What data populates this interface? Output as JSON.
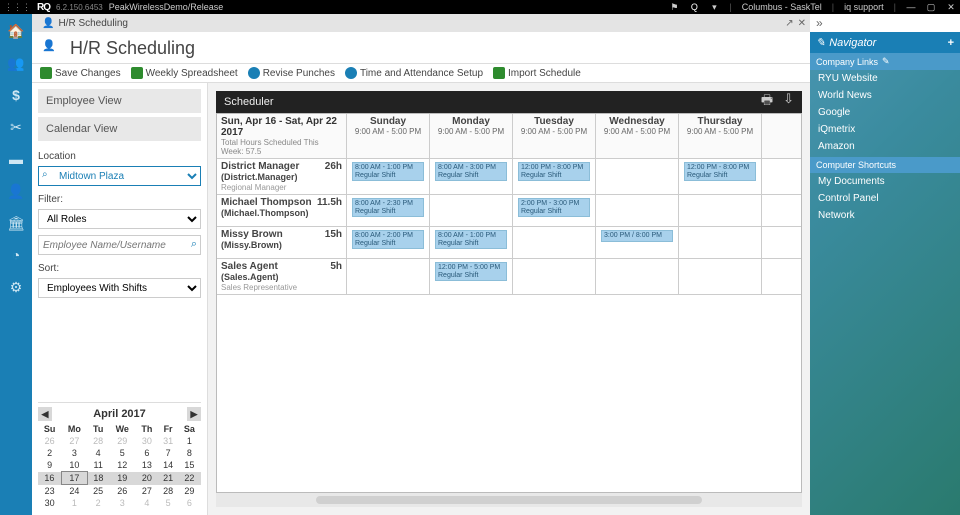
{
  "titlebar": {
    "version": "6.2.150.6453",
    "title": "PeakWirelessDemo/Release",
    "region": "Columbus - SaskTel",
    "support": "iq support"
  },
  "tab": {
    "title": "H/R Scheduling"
  },
  "page": {
    "title": "H/R Scheduling"
  },
  "toolbar": {
    "save": "Save Changes",
    "weekly": "Weekly Spreadsheet",
    "revise": "Revise Punches",
    "time": "Time and Attendance Setup",
    "import": "Import Schedule"
  },
  "sidepane": {
    "empview": "Employee View",
    "calview": "Calendar View",
    "locationLabel": "Location",
    "location": "Midtown Plaza",
    "filterLabel": "Filter:",
    "filter": "All Roles",
    "searchPh": "Employee Name/Username",
    "sortLabel": "Sort:",
    "sort": "Employees With Shifts"
  },
  "minical": {
    "month": "April  2017",
    "dow": [
      "Su",
      "Mo",
      "Tu",
      "We",
      "Th",
      "Fr",
      "Sa"
    ],
    "weeks": [
      [
        {
          "d": "26",
          "o": 1
        },
        {
          "d": "27",
          "o": 1
        },
        {
          "d": "28",
          "o": 1
        },
        {
          "d": "29",
          "o": 1
        },
        {
          "d": "30",
          "o": 1
        },
        {
          "d": "31",
          "o": 1
        },
        {
          "d": "1"
        }
      ],
      [
        {
          "d": "2"
        },
        {
          "d": "3"
        },
        {
          "d": "4"
        },
        {
          "d": "5"
        },
        {
          "d": "6"
        },
        {
          "d": "7"
        },
        {
          "d": "8"
        }
      ],
      [
        {
          "d": "9"
        },
        {
          "d": "10"
        },
        {
          "d": "11"
        },
        {
          "d": "12"
        },
        {
          "d": "13"
        },
        {
          "d": "14"
        },
        {
          "d": "15"
        }
      ],
      [
        {
          "d": "16"
        },
        {
          "d": "17",
          "today": 1
        },
        {
          "d": "18"
        },
        {
          "d": "19"
        },
        {
          "d": "20"
        },
        {
          "d": "21"
        },
        {
          "d": "22"
        }
      ],
      [
        {
          "d": "23"
        },
        {
          "d": "24"
        },
        {
          "d": "25"
        },
        {
          "d": "26"
        },
        {
          "d": "27"
        },
        {
          "d": "28"
        },
        {
          "d": "29"
        }
      ],
      [
        {
          "d": "30"
        },
        {
          "d": "1",
          "o": 1
        },
        {
          "d": "2",
          "o": 1
        },
        {
          "d": "3",
          "o": 1
        },
        {
          "d": "4",
          "o": 1
        },
        {
          "d": "5",
          "o": 1
        },
        {
          "d": "6",
          "o": 1
        }
      ]
    ],
    "selweek": 3
  },
  "sched": {
    "title": "Scheduler",
    "range": "Sun, Apr 16 - Sat, Apr 22 2017",
    "totalhrs": "Total Hours Scheduled This Week: 57.5",
    "days": [
      {
        "name": "Sunday",
        "hrs": "9:00 AM - 5:00 PM"
      },
      {
        "name": "Monday",
        "hrs": "9:00 AM - 5:00 PM"
      },
      {
        "name": "Tuesday",
        "hrs": "9:00 AM - 5:00 PM"
      },
      {
        "name": "Wednesday",
        "hrs": "9:00 AM - 5:00 PM"
      },
      {
        "name": "Thursday",
        "hrs": "9:00 AM - 5:00 PM"
      }
    ],
    "rows": [
      {
        "name": "District Manager",
        "user": "(District.Manager)",
        "role": "Regional Manager",
        "hrs": "26h",
        "cells": [
          "8:00 AM - 1:00 PM\nRegular Shift",
          "8:00 AM - 3:00 PM\nRegular Shift",
          "12:00 PM - 8:00 PM\nRegular Shift",
          "",
          "12:00 PM - 8:00 PM\nRegular Shift"
        ]
      },
      {
        "name": "Michael Thompson",
        "user": "(Michael.Thompson)",
        "role": "",
        "hrs": "11.5h",
        "cells": [
          "8:00 AM - 2:30\nPM\nRegular Shift",
          "",
          "2:00 PM - 3:00\nPM\nRegular Shift",
          "",
          ""
        ]
      },
      {
        "name": "Missy Brown",
        "user": "(Missy.Brown)",
        "role": "",
        "hrs": "15h",
        "cells": [
          "8:00 AM - 2:00\nPM\nRegular Shift",
          "8:00 AM - 1:00\nPM\nRegular Shift",
          "",
          "3:00 PM / 8:00\nPM",
          ""
        ]
      },
      {
        "name": "Sales Agent",
        "user": "(Sales.Agent)",
        "role": "Sales Representative",
        "hrs": "5h",
        "cells": [
          "",
          "12:00 PM - 5:00\nPM\nRegular Shift",
          "",
          "",
          ""
        ]
      }
    ]
  },
  "nav": {
    "title": "Navigator",
    "sec1": "Company Links",
    "links1": [
      "RYU Website",
      "World News",
      "Google",
      "iQmetrix",
      "Amazon"
    ],
    "sec2": "Computer Shortcuts",
    "links2": [
      "My Documents",
      "Control Panel",
      "Network"
    ]
  }
}
